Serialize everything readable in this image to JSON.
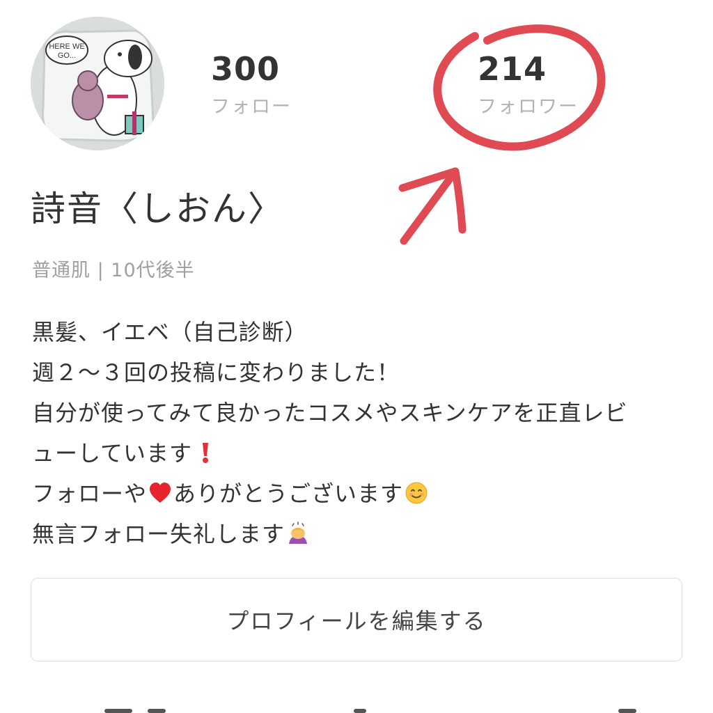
{
  "profile": {
    "avatar_icon": "snoopy-keychain-avatar",
    "avatar_text": "HERE WE GO...",
    "username": "詩音〈しおん〉",
    "meta": "普通肌 | 10代後半"
  },
  "stats": {
    "following": {
      "count": "300",
      "label": "フォロー"
    },
    "followers": {
      "count": "214",
      "label": "フォロワー"
    }
  },
  "annotation": {
    "color": "#e04a52",
    "shape": "circle-and-arrow"
  },
  "bio": {
    "line1": "黒髪、イエベ（自己診断）",
    "line2": "週２〜３回の投稿に変わりました！",
    "line3": "自分が使ってみて良かったコスメやスキンケアを正直レビ",
    "line4_text": "ューしています",
    "line4_emoji": "exclamation-icon",
    "line5_a": "フォローや",
    "line5_emoji1": "heart-icon",
    "line5_b": "ありがとうございます",
    "line5_emoji2": "smile-icon",
    "line6_text": "無言フォロー失礼します",
    "line6_emoji": "bowing-person-icon"
  },
  "actions": {
    "edit_profile_label": "プロフィールを編集する"
  }
}
